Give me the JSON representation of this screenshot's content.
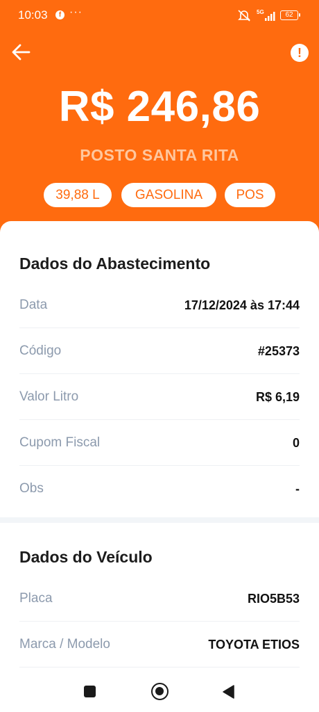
{
  "status_bar": {
    "time": "10:03",
    "app_icon": "facebook-icon",
    "more_indicator": "···",
    "network": "5G",
    "battery": "62"
  },
  "header": {
    "amount": "R$ 246,86",
    "station": "POSTO SANTA RITA",
    "chips": {
      "volume": "39,88 L",
      "fuel": "GASOLINA",
      "payment": "POS"
    },
    "accent_color": "#FF6B0F",
    "back_icon": "arrow-left-icon",
    "alert_icon": "exclamation-circle-icon"
  },
  "refuel_section": {
    "title": "Dados do Abastecimento",
    "rows": [
      {
        "label": "Data",
        "value": "17/12/2024 às 17:44"
      },
      {
        "label": "Código",
        "value": "#25373"
      },
      {
        "label": "Valor Litro",
        "value": "R$ 6,19"
      },
      {
        "label": "Cupom Fiscal",
        "value": "0"
      },
      {
        "label": "Obs",
        "value": "-"
      }
    ]
  },
  "vehicle_section": {
    "title": "Dados do Veículo",
    "rows": [
      {
        "label": "Placa",
        "value": "RIO5B53"
      },
      {
        "label": "Marca / Modelo",
        "value": "TOYOTA ETIOS"
      }
    ]
  },
  "alert_symbol": "!"
}
